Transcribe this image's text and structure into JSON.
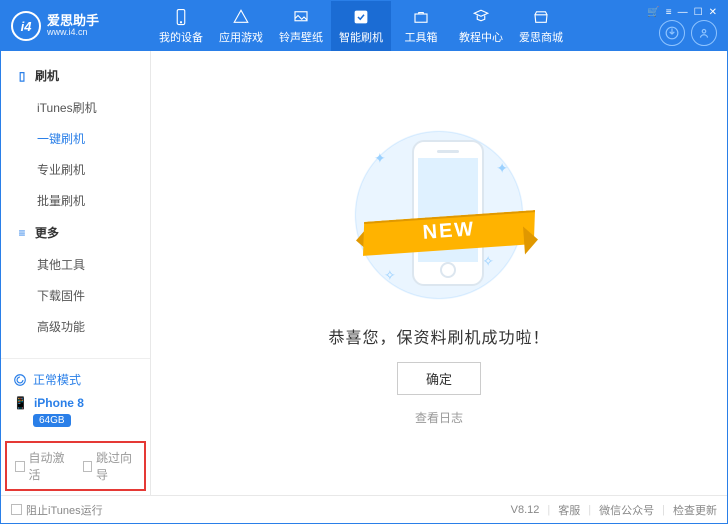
{
  "header": {
    "app_name": "爱思助手",
    "app_url": "www.i4.cn",
    "tabs": [
      {
        "label": "我的设备"
      },
      {
        "label": "应用游戏"
      },
      {
        "label": "铃声壁纸"
      },
      {
        "label": "智能刷机"
      },
      {
        "label": "工具箱"
      },
      {
        "label": "教程中心"
      },
      {
        "label": "爱思商城"
      }
    ]
  },
  "sidebar": {
    "groups": [
      {
        "title": "刷机",
        "items": [
          "iTunes刷机",
          "一键刷机",
          "专业刷机",
          "批量刷机"
        ]
      },
      {
        "title": "更多",
        "items": [
          "其他工具",
          "下载固件",
          "高级功能"
        ]
      }
    ],
    "mode": "正常模式",
    "device": {
      "name": "iPhone 8",
      "capacity": "64GB"
    },
    "checks": [
      "自动激活",
      "跳过向导"
    ]
  },
  "main": {
    "ribbon": "NEW",
    "message": "恭喜您，保资料刷机成功啦！",
    "confirm": "确定",
    "view_log": "查看日志"
  },
  "status": {
    "block_itunes": "阻止iTunes运行",
    "version": "V8.12",
    "support": "客服",
    "wechat": "微信公众号",
    "update": "检查更新"
  }
}
